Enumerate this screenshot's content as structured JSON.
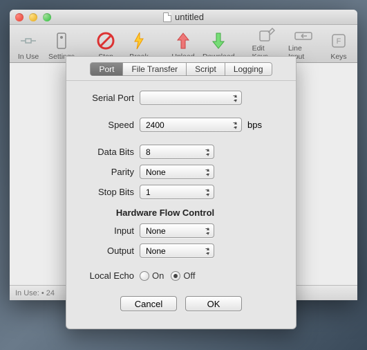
{
  "window": {
    "title": "untitled"
  },
  "toolbar": {
    "items": [
      {
        "label": "In Use"
      },
      {
        "label": "Settings"
      },
      {
        "label": "Stop"
      },
      {
        "label": "Break"
      },
      {
        "label": "Upload"
      },
      {
        "label": "Download"
      },
      {
        "label": "Edit Keys"
      },
      {
        "label": "Line Input"
      },
      {
        "label": "Keys"
      }
    ]
  },
  "statusbar": {
    "text": "In Use:  • 24"
  },
  "tabs": [
    "Port",
    "File Transfer",
    "Script",
    "Logging"
  ],
  "tab_selected": "Port",
  "form": {
    "serial_port": {
      "label": "Serial Port",
      "value": ""
    },
    "speed": {
      "label": "Speed",
      "value": "2400",
      "suffix": "bps"
    },
    "data_bits": {
      "label": "Data Bits",
      "value": "8"
    },
    "parity": {
      "label": "Parity",
      "value": "None"
    },
    "stop_bits": {
      "label": "Stop Bits",
      "value": "1"
    },
    "flow_title": "Hardware Flow Control",
    "input": {
      "label": "Input",
      "value": "None"
    },
    "output": {
      "label": "Output",
      "value": "None"
    },
    "local_echo": {
      "label": "Local Echo",
      "on": "On",
      "off": "Off",
      "value": "Off"
    }
  },
  "buttons": {
    "cancel": "Cancel",
    "ok": "OK"
  }
}
